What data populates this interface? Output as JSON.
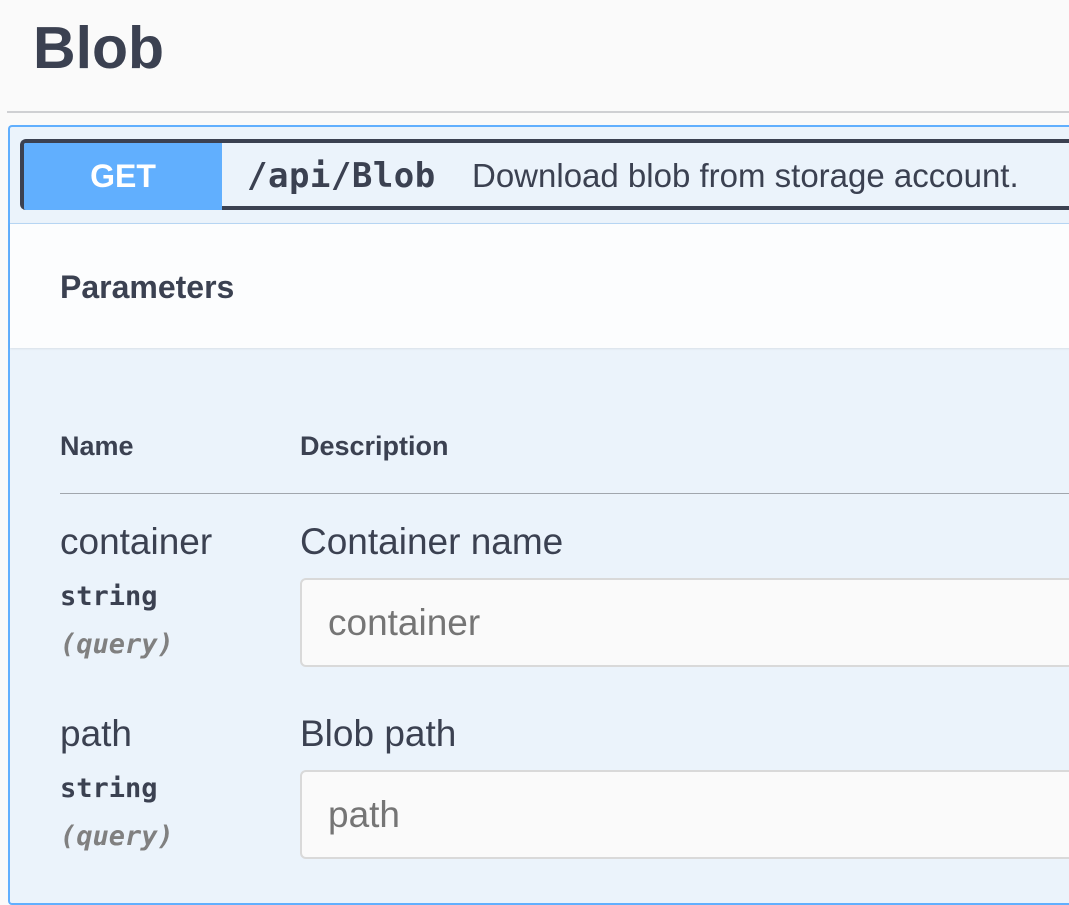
{
  "section": {
    "title": "Blob"
  },
  "operation": {
    "method": "GET",
    "path": "/api/Blob",
    "summary": "Download blob from storage account."
  },
  "parameters": {
    "title": "Parameters",
    "columns": {
      "name": "Name",
      "description": "Description"
    },
    "items": [
      {
        "name": "container",
        "type": "string",
        "in": "(query)",
        "description": "Container name",
        "value": "",
        "placeholder": "container"
      },
      {
        "name": "path",
        "type": "string",
        "in": "(query)",
        "description": "Blob path",
        "value": "",
        "placeholder": "path"
      }
    ]
  },
  "colors": {
    "get": "#61affe",
    "get_bg": "#ebf3fb",
    "text": "#3b4151"
  }
}
